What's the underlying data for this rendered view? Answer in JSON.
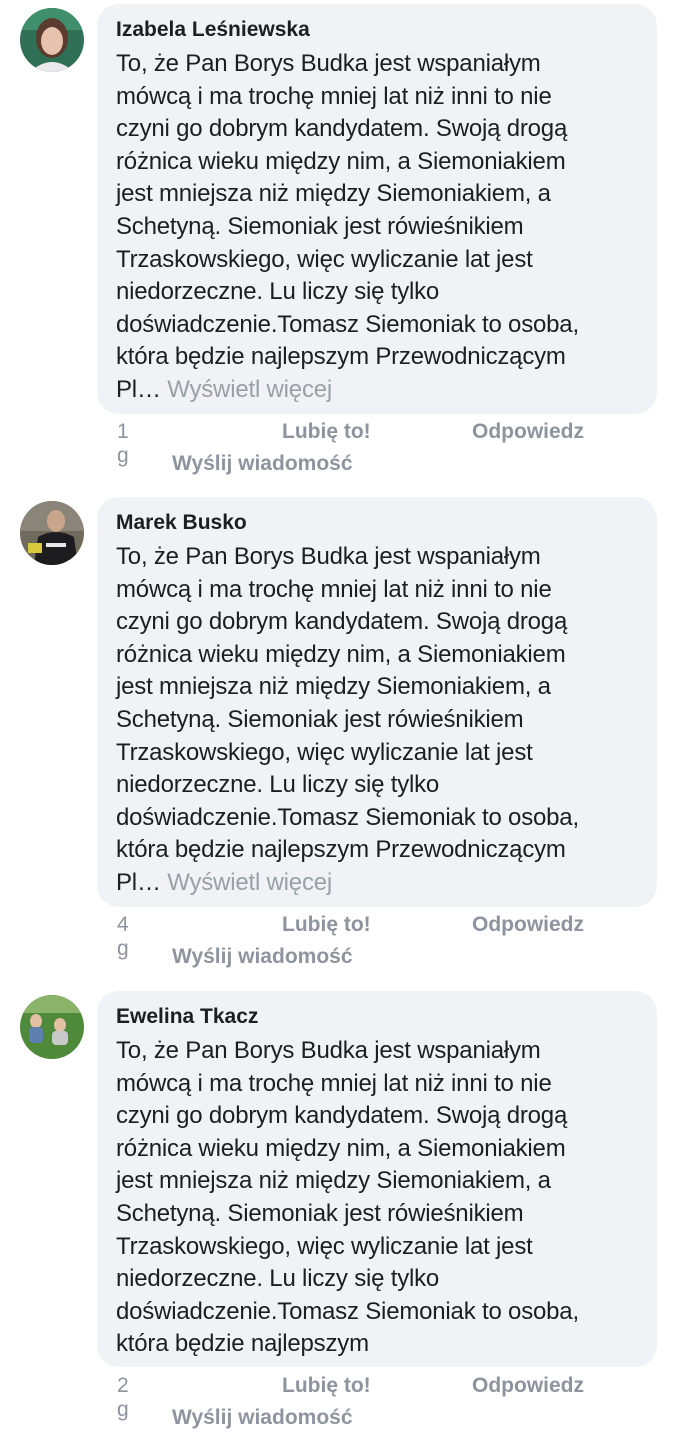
{
  "comments": [
    {
      "author": "Izabela Leśniewska",
      "lines": [
        "To, że Pan Borys Budka jest wspaniałym",
        "mówcą i ma trochę mniej lat niż inni to nie",
        "czyni go dobrym kandydatem. Swoją drogą",
        "różnica wieku między nim, a Siemoniakiem",
        "jest mniejsza niż między Siemoniakiem, a",
        "Schetyną. Siemoniak jest rówieśnikiem",
        "Trzaskowskiego, więc wyliczanie lat jest",
        "niedorzeczne. Lu liczy się tylko",
        "doświadczenie.Tomasz Siemoniak to osoba,",
        "która będzie najlepszym Przewodniczącym"
      ],
      "truncated_tail": "Pl…",
      "see_more": "Wyświetl więcej",
      "time": "1 g",
      "like": "Lubię to!",
      "reply": "Odpowiedz",
      "send": "Wyślij wiadomość"
    },
    {
      "author": "Marek Busko",
      "lines": [
        "To, że Pan Borys Budka jest wspaniałym",
        "mówcą i ma trochę mniej lat niż inni to nie",
        "czyni go dobrym kandydatem. Swoją drogą",
        "różnica wieku między nim, a Siemoniakiem",
        "jest mniejsza niż między Siemoniakiem, a",
        "Schetyną. Siemoniak jest rówieśnikiem",
        "Trzaskowskiego, więc wyliczanie lat jest",
        "niedorzeczne. Lu liczy się tylko",
        "doświadczenie.Tomasz Siemoniak to osoba,",
        "która będzie najlepszym Przewodniczącym"
      ],
      "truncated_tail": "Pl…",
      "see_more": "Wyświetl więcej",
      "time": "4 g",
      "like": "Lubię to!",
      "reply": "Odpowiedz",
      "send": "Wyślij wiadomość"
    },
    {
      "author": "Ewelina Tkacz",
      "lines": [
        "To, że Pan Borys Budka jest wspaniałym",
        "mówcą i ma trochę mniej lat niż inni to nie",
        "czyni go dobrym kandydatem. Swoją drogą",
        "różnica wieku między nim, a Siemoniakiem",
        "jest mniejsza niż między Siemoniakiem, a",
        "Schetyną. Siemoniak jest rówieśnikiem",
        "Trzaskowskiego, więc wyliczanie lat jest",
        "niedorzeczne. Lu liczy się tylko",
        "doświadczenie.Tomasz Siemoniak to osoba,",
        "która będzie najlepszym"
      ],
      "time": "2 g",
      "like": "Lubię to!",
      "reply": "Odpowiedz",
      "send": "Wyślij wiadomość"
    }
  ]
}
